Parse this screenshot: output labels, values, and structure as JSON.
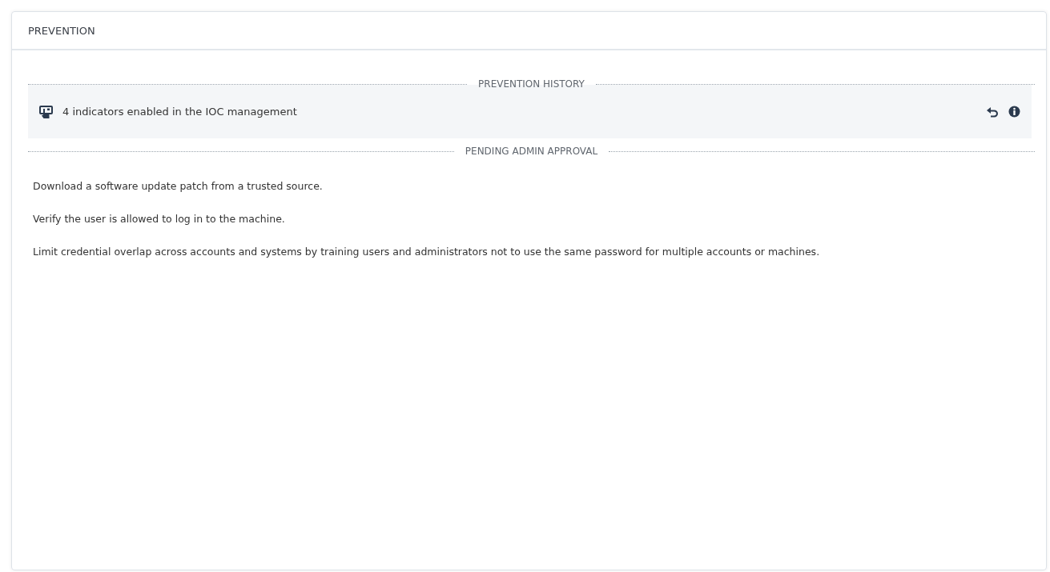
{
  "panel": {
    "title": "PREVENTION"
  },
  "sections": [
    {
      "kind": "history",
      "title": "PREVENTION HISTORY",
      "items": [
        {
          "text": "4 indicators enabled in the IOC management"
        }
      ]
    },
    {
      "kind": "pending",
      "title": "PENDING ADMIN APPROVAL",
      "items": [
        {
          "text": "Download a software update patch from a trusted source."
        },
        {
          "text": "Verify the user is allowed to log in to the machine."
        },
        {
          "text": "Limit credential overlap across accounts and systems by training users and administrators not to use the same password for multiple accounts or machines."
        }
      ]
    }
  ]
}
